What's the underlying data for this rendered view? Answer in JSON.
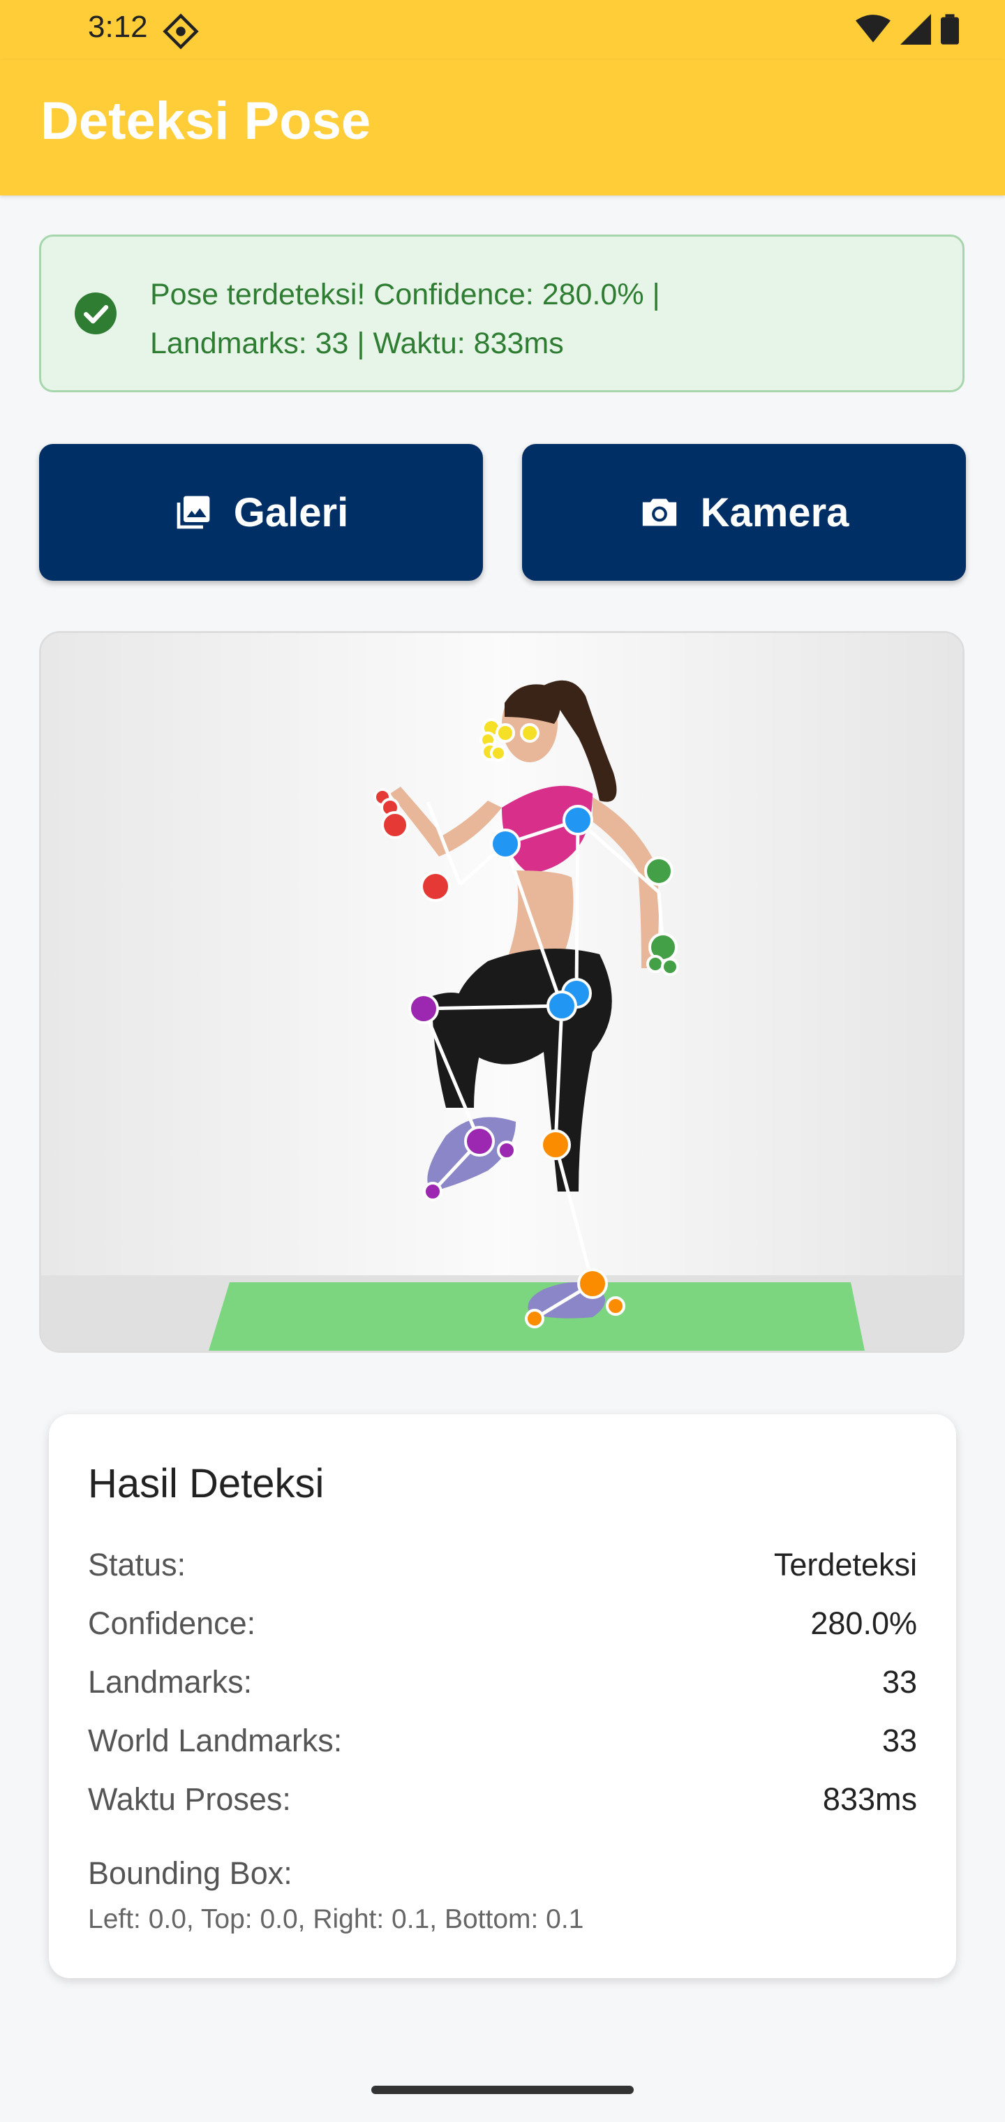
{
  "status_bar": {
    "time": "3:12",
    "icons": [
      "location-diamond-icon",
      "wifi-icon",
      "signal-icon",
      "battery-icon"
    ]
  },
  "app_bar": {
    "title": "Deteksi Pose"
  },
  "banner": {
    "line1": "Pose terdeteksi! Confidence: 280.0% |",
    "line2": "Landmarks: 33 | Waktu: 833ms",
    "icon": "check-circle-icon"
  },
  "buttons": {
    "gallery": {
      "label": "Galeri",
      "icon": "photo-library-icon"
    },
    "camera": {
      "label": "Kamera",
      "icon": "camera-icon"
    }
  },
  "results": {
    "title": "Hasil Deteksi",
    "rows": [
      {
        "label": "Status:",
        "value": "Terdeteksi"
      },
      {
        "label": "Confidence:",
        "value": "280.0%"
      },
      {
        "label": "Landmarks:",
        "value": "33"
      },
      {
        "label": "World Landmarks:",
        "value": "33"
      },
      {
        "label": "Waktu Proses:",
        "value": "833ms"
      }
    ],
    "bbox_label": "Bounding Box:",
    "bbox_value": "Left: 0.0, Top: 0.0, Right: 0.1, Bottom: 0.1"
  },
  "colors": {
    "accent": "#ffcd38",
    "button": "#002f66",
    "success_bg": "#e7f5e8",
    "success_text": "#2e7d32",
    "landmark_face": "#f6e027",
    "landmark_torso": "#2196f3",
    "landmark_right_arm": "#e53935",
    "landmark_left_arm": "#43a047",
    "landmark_right_leg": "#9c27b0",
    "landmark_left_leg": "#fb8c00"
  }
}
